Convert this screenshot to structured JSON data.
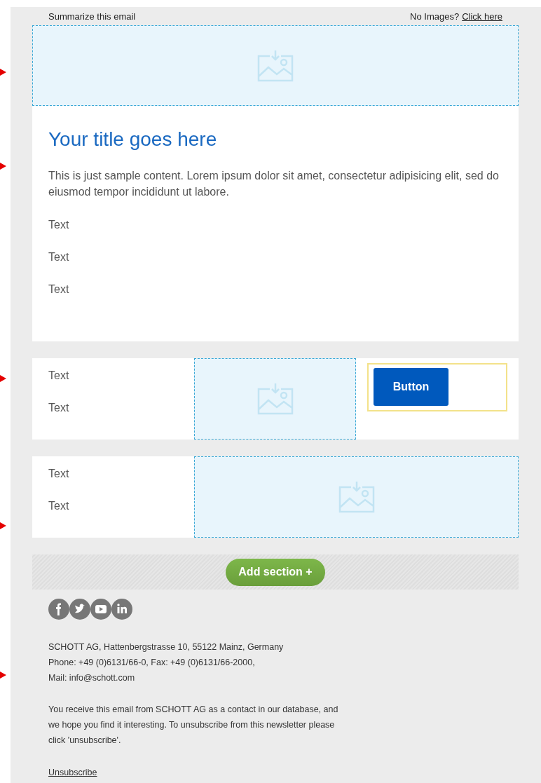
{
  "header": {
    "summary_link": "Summarize this email",
    "no_images_text": "No Images?",
    "no_images_link": "Click here"
  },
  "sections": [
    {
      "kind": "image-banner"
    },
    {
      "kind": "content",
      "title": "Your title goes here",
      "body": "This is just sample content. Lorem ipsum dolor sit amet, consectetur adipisicing elit, sed do eiusmod tempor incididunt ut labore.",
      "texts": [
        "Text",
        "Text",
        "Text"
      ]
    },
    {
      "kind": "text-image-button",
      "texts": [
        "Text",
        "Text"
      ],
      "button": "Button"
    },
    {
      "kind": "text-image",
      "texts": [
        "Text",
        "Text"
      ]
    }
  ],
  "add_section_button": "Add section +",
  "footer": {
    "address": [
      "SCHOTT AG, Hattenbergstrasse 10, 55122 Mainz, Germany",
      "Phone: +49 (0)6131/66-0, Fax: +49 (0)6131/66-2000,",
      "Mail: info@schott.com"
    ],
    "disclaimer": "You receive this email from SCHOTT AG as a contact in our database, and we hope you find it interesting. To unsubscribe from this newsletter please click 'unsubscribe'.",
    "unsubscribe_link": "Unsubscribe"
  }
}
